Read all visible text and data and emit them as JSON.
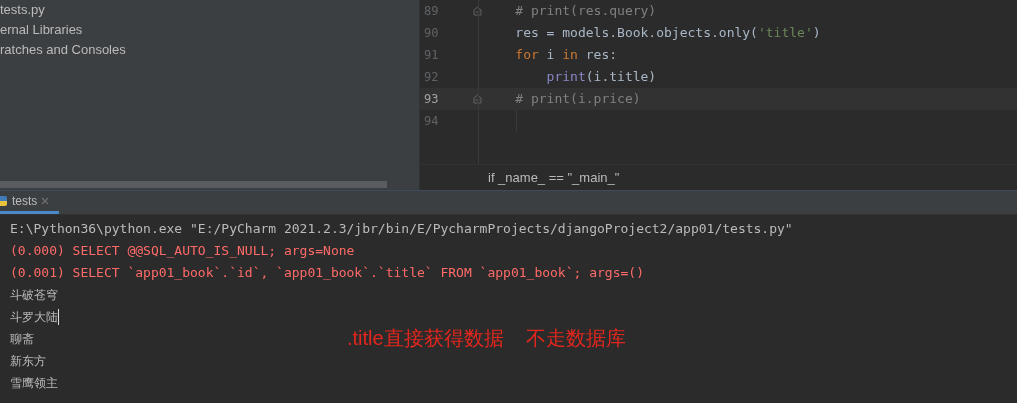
{
  "project_tree": {
    "items": [
      {
        "label": "tests.py"
      },
      {
        "label": "ernal Libraries"
      },
      {
        "label": "ratches and Consoles"
      }
    ]
  },
  "editor": {
    "lines": [
      {
        "number": "89",
        "current": false,
        "fold": true,
        "tokens": [
          {
            "text": "    # print(res.query)",
            "kind": "comment"
          }
        ]
      },
      {
        "number": "90",
        "current": false,
        "fold": false,
        "tokens": [
          {
            "text": "    res = models.Book.objects.only(",
            "kind": "plain"
          },
          {
            "text": "'title'",
            "kind": "string"
          },
          {
            "text": ")",
            "kind": "plain"
          }
        ]
      },
      {
        "number": "91",
        "current": false,
        "fold": false,
        "tokens": [
          {
            "text": "    for",
            "kind": "keyword"
          },
          {
            "text": " i ",
            "kind": "plain"
          },
          {
            "text": "in",
            "kind": "keyword"
          },
          {
            "text": " res:",
            "kind": "plain"
          }
        ]
      },
      {
        "number": "92",
        "current": false,
        "fold": false,
        "tokens": [
          {
            "text": "        print",
            "kind": "builtin"
          },
          {
            "text": "(i.title)",
            "kind": "plain"
          }
        ]
      },
      {
        "number": "93",
        "current": true,
        "fold": true,
        "tokens": [
          {
            "text": "    # print(i.price)",
            "kind": "comment"
          }
        ]
      },
      {
        "number": "94",
        "current": false,
        "fold": false
      }
    ],
    "breadcrumb": "if _name_ == \"_main_\""
  },
  "run_panel": {
    "tabs": [
      {
        "label": "tests",
        "selected": true
      }
    ],
    "lines": [
      {
        "kind": "command",
        "text": "E:\\Python36\\python.exe \"E:/PyCharm 2021.2.3/jbr/bin/E/PycharmProjects/djangoProject2/app01/tests.py\"",
        "caret": false
      },
      {
        "kind": "sql",
        "text": "(0.000) SELECT @@SQL_AUTO_IS_NULL; args=None",
        "caret": false
      },
      {
        "kind": "sql",
        "text": "(0.001) SELECT `app01_book`.`id`, `app01_book`.`title` FROM `app01_book`; args=()",
        "caret": false
      },
      {
        "kind": "output",
        "text": "斗破苍穹",
        "caret": false
      },
      {
        "kind": "output",
        "text": "斗罗大陆",
        "caret": true
      },
      {
        "kind": "output",
        "text": "聊斋",
        "caret": false
      },
      {
        "kind": "output",
        "text": "新东方",
        "caret": false
      },
      {
        "kind": "output",
        "text": "雪鹰领主",
        "caret": false
      }
    ],
    "annotation": ".title直接获得数据    不走数据库"
  }
}
